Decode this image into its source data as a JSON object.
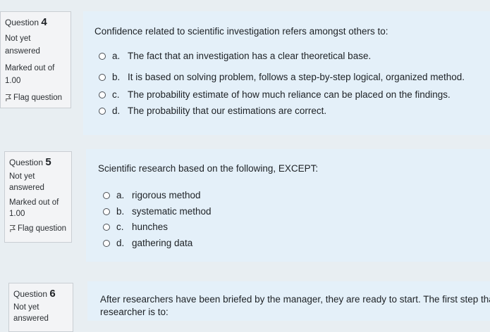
{
  "questions": [
    {
      "label": "Question",
      "number": "4",
      "status_line1": "Not yet",
      "status_line2": "answered",
      "marked_label": "Marked out of",
      "marked_value": "1.00",
      "flag_label": "Flag question",
      "text": "Confidence related to scientific investigation refers amongst others to:",
      "options": [
        {
          "letter": "a.",
          "text": "The fact that an investigation has a clear theoretical base."
        },
        {
          "letter": "b.",
          "text": "It is based on solving problem, follows a step-by-step logical, organized method."
        },
        {
          "letter": "c.",
          "text": "The probability estimate of how much reliance can be placed on the findings."
        },
        {
          "letter": "d.",
          "text": "The probability that our estimations are correct."
        }
      ]
    },
    {
      "label": "Question",
      "number": "5",
      "status_line1": "Not yet",
      "status_line2": "answered",
      "marked_label": "Marked out of",
      "marked_value": "1.00",
      "flag_label": "Flag question",
      "text": "Scientific research based on the following, EXCEPT:",
      "options": [
        {
          "letter": "a.",
          "text": "rigorous method"
        },
        {
          "letter": "b.",
          "text": "systematic method"
        },
        {
          "letter": "c.",
          "text": "hunches"
        },
        {
          "letter": "d.",
          "text": "gathering data"
        }
      ]
    },
    {
      "label": "Question",
      "number": "6",
      "status_line1": "Not yet",
      "status_line2": "answered",
      "text_line1": "After researchers have been briefed by the manager, they are ready to start. The first step that r",
      "text_line2": "researcher is to:"
    }
  ]
}
